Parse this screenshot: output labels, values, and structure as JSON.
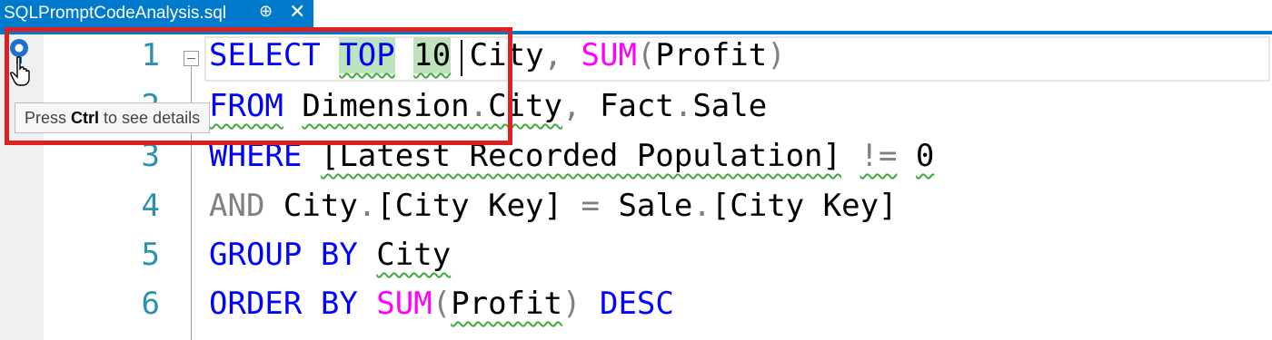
{
  "tab": {
    "filename": "SQLPromptCodeAnalysis.sql",
    "pin_glyph": "⊕",
    "close_glyph": "✕"
  },
  "tooltip": {
    "prefix": "Press ",
    "key": "Ctrl",
    "suffix": " to see details"
  },
  "line_numbers": [
    "1",
    "2",
    "3",
    "4",
    "5",
    "6"
  ],
  "code": {
    "l1": {
      "select": "SELECT",
      "top": "TOP",
      "num": "10",
      "city": "City",
      "comma": ",",
      "sum": "SUM",
      "lp": "(",
      "profit": "Profit",
      "rp": ")"
    },
    "l2": {
      "from": "FROM",
      "dim": "Dimension",
      "dot1": ".",
      "city": "City",
      "comma": ",",
      "fact": "Fact",
      "dot2": ".",
      "sale": "Sale"
    },
    "l3": {
      "where": "WHERE",
      "col": "[Latest Recorded Population]",
      "ne": "!=",
      "zero": "0"
    },
    "l4": {
      "and": "AND",
      "city": "City",
      "dot1": ".",
      "key1": "[City Key]",
      "eq": "=",
      "sale": "Sale",
      "dot2": ".",
      "key2": "[City Key]"
    },
    "l5": {
      "group": "GROUP",
      "by": "BY",
      "city": "City"
    },
    "l6": {
      "order": "ORDER",
      "by": "BY",
      "sum": "SUM",
      "lp": "(",
      "profit": "Profit",
      "rp": ")",
      "desc": "DESC"
    }
  },
  "colors": {
    "keyword": "#0000ff",
    "function": "#ff00ff",
    "operator": "#808080",
    "line_number": "#2b91af",
    "tab_accent": "#007acc",
    "squiggle": "#3cab3c",
    "highlight_box": "#e02020"
  },
  "icons": {
    "bulb": "lightbulb-icon",
    "cursor": "hand-pointer-icon",
    "fold": "collapse-minus-icon"
  }
}
